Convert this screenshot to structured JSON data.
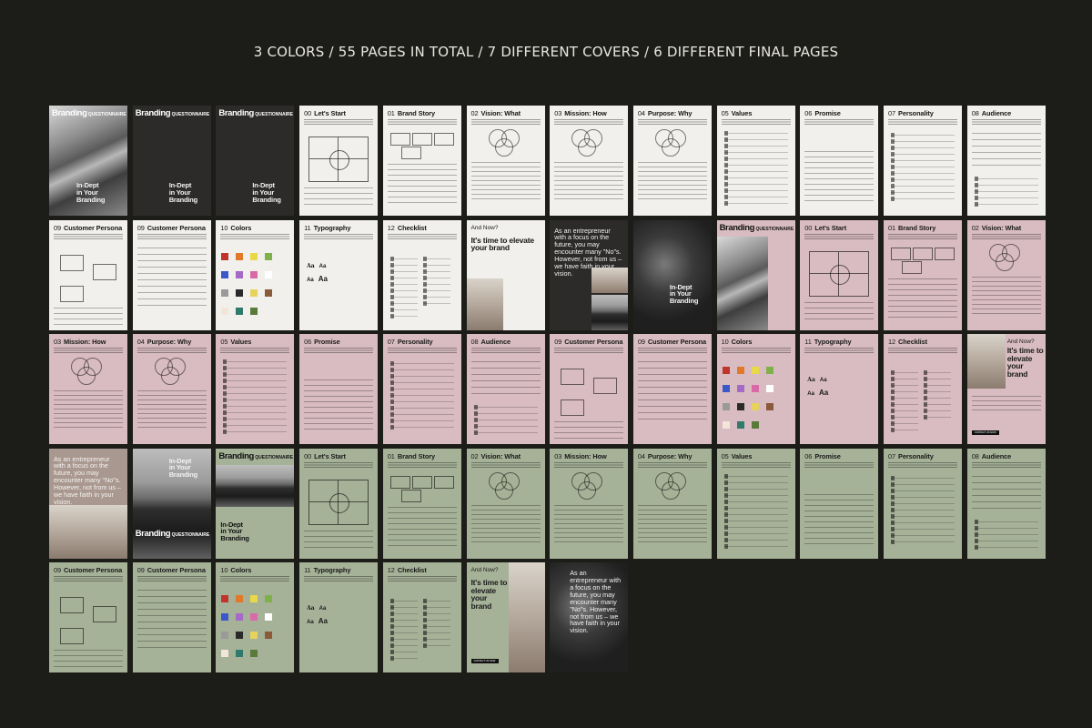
{
  "headline": "3 COLORS / 55 PAGES IN TOTAL / 7 DIFFERENT COVERS / 6 DIFFERENT FINAL PAGES",
  "cover": {
    "brand": "Branding",
    "word": "QUESTIONNAIRE",
    "subtitle": "In-Dept in Your Branding",
    "subtitle_lines": [
      "In-Dept",
      "in Your",
      "Branding"
    ]
  },
  "pages": {
    "lets_start": {
      "num": "00",
      "title": "Let's Start"
    },
    "brand_story": {
      "num": "01",
      "title": "Brand Story"
    },
    "vision": {
      "num": "02",
      "title": "Vision: What"
    },
    "mission": {
      "num": "03",
      "title": "Mission: How"
    },
    "purpose": {
      "num": "04",
      "title": "Purpose: Why"
    },
    "values": {
      "num": "05",
      "title": "Values"
    },
    "promise": {
      "num": "06",
      "title": "Promise"
    },
    "personality": {
      "num": "07",
      "title": "Personality"
    },
    "audience": {
      "num": "08",
      "title": "Audience"
    },
    "persona": {
      "num": "09",
      "title": "Customer Persona"
    },
    "colors": {
      "num": "10",
      "title": "Colors"
    },
    "typography": {
      "num": "11",
      "title": "Typography"
    },
    "checklist": {
      "num": "12",
      "title": "Checklist"
    }
  },
  "final": {
    "and_now": "And Now?",
    "elevate": "It's time to elevate your brand",
    "elevate_lines": [
      "It's time",
      "to elevate",
      "your",
      "brand"
    ],
    "quote": "As an entrepreneur with a focus on the future, you may encounter many \"No\"s. However, not from us – we have faith in your vision.",
    "button": "CONTACT US NOW"
  },
  "swatch_colors": [
    "#c0342c",
    "#e07a2a",
    "#e9d84a",
    "#7fb04a",
    "#3a58c9",
    "#a569c8",
    "#d96aa8",
    "#ffffff",
    "#9a9a9a",
    "#2a2a2a",
    "#e6d25c",
    "#8a5a3a",
    "#f2e6d8",
    "#2f7a6a",
    "#5a7a3a"
  ]
}
